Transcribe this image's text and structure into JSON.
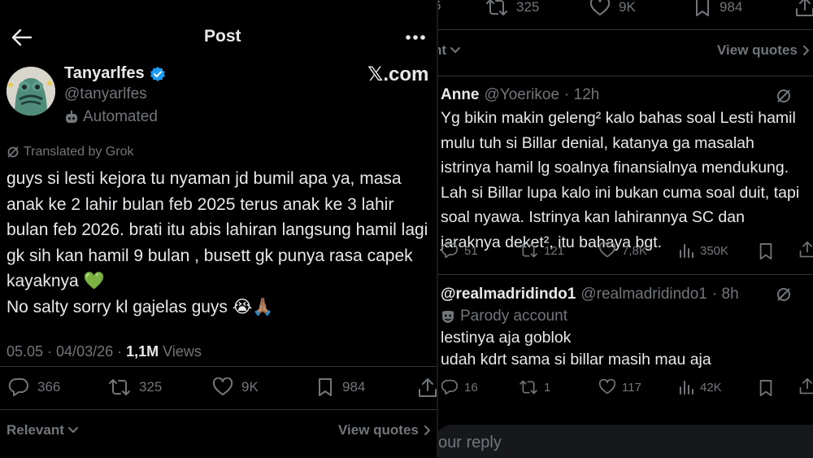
{
  "left": {
    "header": {
      "title": "Post",
      "brand": "𝕏.com",
      "back_icon": "arrow-left-icon",
      "more_icon": "more-dots-icon"
    },
    "author": {
      "name": "Tanyarlfes",
      "handle": "@tanyarlfes",
      "verified_color": "#1d9bf0",
      "automated_label": "Automated"
    },
    "translated_label": "Translated by Grok",
    "tweet": {
      "line1": "guys si lesti kejora tu nyaman jd bumil apa ya, masa anak ke 2 lahir bulan feb 2025 terus anak ke 3 lahir bulan feb 2026. brati itu abis lahiran langsung hamil lagi gk sih kan hamil 9 bulan , busett gk punya rasa capek kayaknya",
      "emoji1": "💚",
      "line2": "No salty sorry kl gajelas guys",
      "emoji2": "😭🙏🏽"
    },
    "meta": {
      "time": "05.05 · 04/03/26 · ",
      "views_count": "1,1M",
      "views_label": " Views"
    },
    "actions": {
      "replies": "366",
      "reposts": "325",
      "likes": "9K",
      "bookmarks": "984"
    },
    "footer": {
      "sort_label": "Relevant",
      "quotes_label": "View quotes"
    }
  },
  "right": {
    "top_actions": {
      "partial": "6",
      "reposts": "325",
      "likes": "9K",
      "bookmarks": "984"
    },
    "sort_partial": "nt",
    "quotes_label": "View quotes",
    "replies": [
      {
        "name": "Anne",
        "handle": "@Yoerikoe",
        "time": "· 12h",
        "text": "Yg bikin makin geleng² kalo bahas soal Lesti hamil\nmulu tuh si Billar denial, katanya ga masalah\nistrinya hamil lg soalnya finansialnya mendukung.\nLah si Billar lupa kalo ini bukan cuma soal duit, tapi\nsoal nyawa. Istrinya kan lahirannya SC dan\njaraknya deket², itu bahaya bgt.",
        "stats": {
          "replies": "51",
          "reposts": "121",
          "likes": "7,8K",
          "views": "350K"
        }
      },
      {
        "name": "@realmadridindo1",
        "handle": "@realmadridindo1",
        "time": "· 8h",
        "parody_label": "Parody account",
        "text": "lestinya aja goblok\nudah kdrt sama si billar masih mau aja",
        "stats": {
          "replies": "16",
          "reposts": "1",
          "likes": "117",
          "views": "42K"
        }
      }
    ],
    "reply_placeholder": "our reply"
  }
}
